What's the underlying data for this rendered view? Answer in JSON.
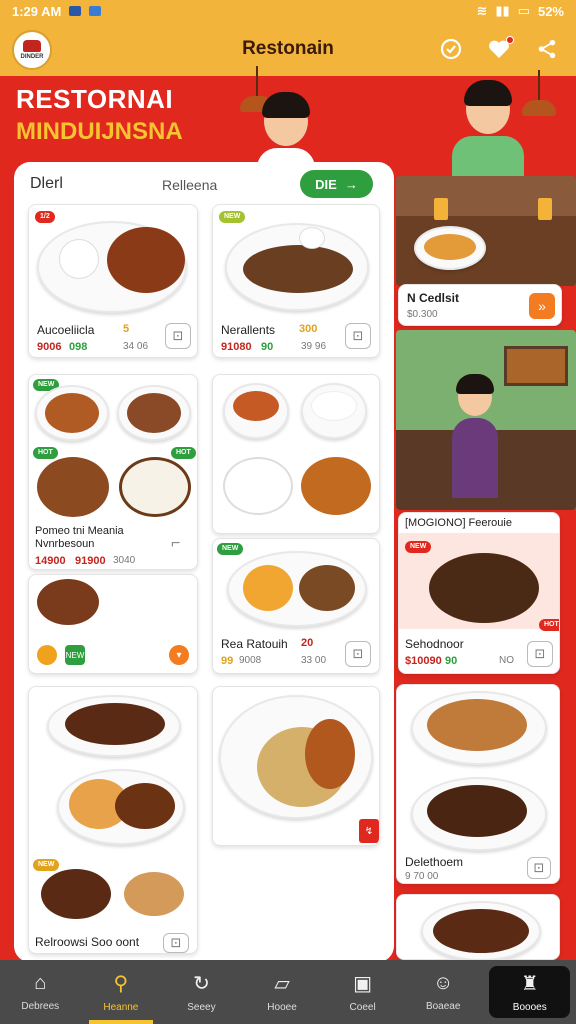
{
  "status": {
    "time": "1:29 AM",
    "battery": "52%"
  },
  "app": {
    "title": "Restonain",
    "logo_text": "DINDER"
  },
  "hero": {
    "line1": "RESTORNAI",
    "line2": "MINDUIJNSNA"
  },
  "panel": {
    "heading": "Dlerl",
    "subheading": "Relleena",
    "filter_label": "DIE"
  },
  "cards": {
    "c1": {
      "tag": "1/2",
      "name": "Aucoeliicla",
      "badge": "5",
      "price": "9006",
      "price2": "098",
      "meta": "34 06"
    },
    "c2": {
      "tag": "NEW",
      "name": "Nerallents",
      "price": "91080",
      "price2": "90",
      "meta": "39 96",
      "badge": "300"
    },
    "c3": {
      "tag": "NEW",
      "tag2": "HOT",
      "tag3": "HOT",
      "name": "Pomeo tni Meania Nvnrbesoun",
      "price": "14900",
      "price2": "91900",
      "meta": "3040"
    },
    "c4": {
      "tag": "NEW"
    },
    "c5": {
      "name": "Rea Ratouih",
      "price": "99",
      "price2": "9008",
      "meta": "33 00",
      "badge": "20"
    },
    "c6": {
      "tag": "NEW",
      "name": "Relroowsi Soo oont"
    },
    "side1": {
      "name": "N Cedlsit",
      "price": "$0.300"
    },
    "side2": {
      "head": "[MOGIONO] Feerouie",
      "name": "Sehodnoor",
      "price": "$10090",
      "price2": "90",
      "meta": "NO",
      "tag": "NEW",
      "tag2": "HOT"
    },
    "side3": {
      "name": "Delethoem",
      "meta": "9 70 00"
    }
  },
  "nav": [
    {
      "label": "Debrees",
      "icon": "home-icon"
    },
    {
      "label": "Heanne",
      "icon": "search-icon"
    },
    {
      "label": "Seeey",
      "icon": "refresh-icon"
    },
    {
      "label": "Hooee",
      "icon": "book-icon"
    },
    {
      "label": "Coeel",
      "icon": "frame-icon"
    },
    {
      "label": "Boaeae",
      "icon": "face-icon"
    },
    {
      "label": "Boooes",
      "icon": "chef-icon"
    }
  ],
  "colors": {
    "primary": "#e0281f",
    "header": "#f2b43a",
    "accent_green": "#2f9e3e",
    "accent_yellow": "#f6c331"
  }
}
